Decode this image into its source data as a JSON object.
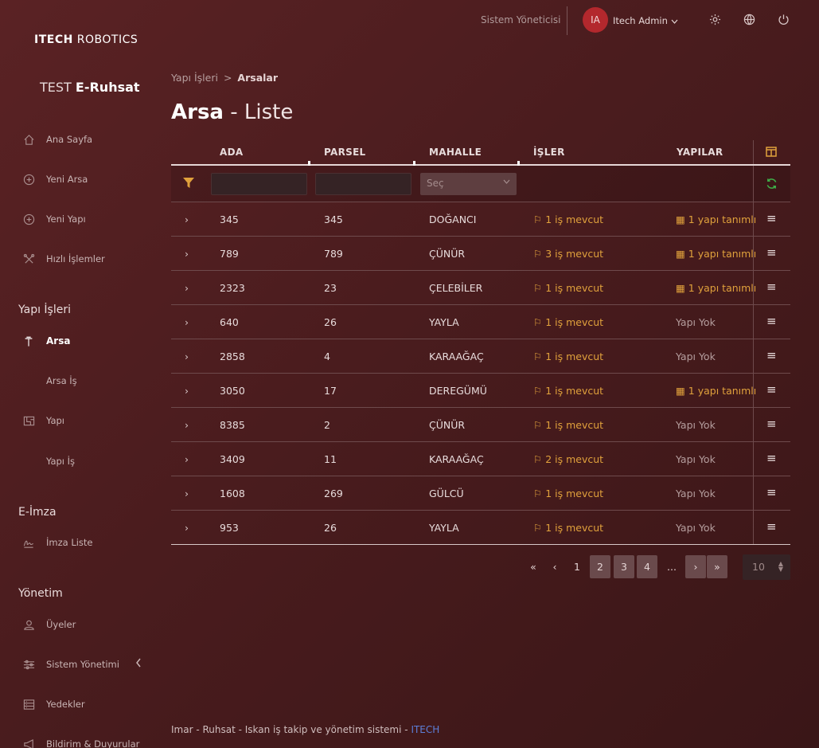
{
  "brand": {
    "logo_bold": "ITECH",
    "logo_rest": "ROBOTICS",
    "app_prefix": "TEST",
    "app_name": "E-Ruhsat"
  },
  "header": {
    "role": "Sistem Yöneticisi",
    "avatar_initials": "IA",
    "user_name": "Itech Admin"
  },
  "sidebar": {
    "items": [
      {
        "label": "Ana Sayfa"
      },
      {
        "label": "Yeni Arsa"
      },
      {
        "label": "Yeni Yapı"
      },
      {
        "label": "Hızlı İşlemler"
      }
    ],
    "section_yapi": "Yapı İşleri",
    "yapi_items": [
      {
        "label": "Arsa"
      },
      {
        "label": "Arsa İş"
      },
      {
        "label": "Yapı"
      },
      {
        "label": "Yapı İş"
      }
    ],
    "section_eimza": "E-İmza",
    "eimza_items": [
      {
        "label": "İmza Liste"
      }
    ],
    "section_yonetim": "Yönetim",
    "yonetim_items": [
      {
        "label": "Üyeler"
      },
      {
        "label": "Sistem Yönetimi"
      },
      {
        "label": "Yedekler"
      },
      {
        "label": "Bildirim & Duyurular"
      }
    ]
  },
  "breadcrumb": {
    "parent": "Yapı İşleri",
    "separator": ">",
    "current": "Arsalar"
  },
  "page": {
    "title_bold": "Arsa",
    "title_rest": "- Liste"
  },
  "table": {
    "columns": [
      "ADA",
      "PARSEL",
      "MAHALLE",
      "İŞLER",
      "YAPILAR"
    ],
    "select_placeholder": "Seç",
    "rows": [
      {
        "ada": "345",
        "parsel": "345",
        "mahalle": "DOĞANCI",
        "isler": "1 iş mevcut",
        "yapilar": "1 yapı tanımlı"
      },
      {
        "ada": "789",
        "parsel": "789",
        "mahalle": "ÇÜNÜR",
        "isler": "3 iş mevcut",
        "yapilar": "1 yapı tanımlı"
      },
      {
        "ada": "2323",
        "parsel": "23",
        "mahalle": "ÇELEBİLER",
        "isler": "1 iş mevcut",
        "yapilar": "1 yapı tanımlı"
      },
      {
        "ada": "640",
        "parsel": "26",
        "mahalle": "YAYLA",
        "isler": "1 iş mevcut",
        "yapilar": "Yapı Yok"
      },
      {
        "ada": "2858",
        "parsel": "4",
        "mahalle": "KARAAĞAÇ",
        "isler": "1 iş mevcut",
        "yapilar": "Yapı Yok"
      },
      {
        "ada": "3050",
        "parsel": "17",
        "mahalle": "DEREGÜMÜ",
        "isler": "1 iş mevcut",
        "yapilar": "1 yapı tanımlı"
      },
      {
        "ada": "8385",
        "parsel": "2",
        "mahalle": "ÇÜNÜR",
        "isler": "1 iş mevcut",
        "yapilar": "Yapı Yok"
      },
      {
        "ada": "3409",
        "parsel": "11",
        "mahalle": "KARAAĞAÇ",
        "isler": "2 iş mevcut",
        "yapilar": "Yapı Yok"
      },
      {
        "ada": "1608",
        "parsel": "269",
        "mahalle": "GÜLCÜ",
        "isler": "1 iş mevcut",
        "yapilar": "Yapı Yok"
      },
      {
        "ada": "953",
        "parsel": "26",
        "mahalle": "YAYLA",
        "isler": "1 iş mevcut",
        "yapilar": "Yapı Yok"
      }
    ]
  },
  "pagination": {
    "first": "«",
    "prev": "‹",
    "pages": [
      "1",
      "2",
      "3",
      "4"
    ],
    "ellipsis": "...",
    "next": "›",
    "last": "»",
    "per_page": "10"
  },
  "footer": {
    "text": "Imar - Ruhsat - Iskan iş takip ve yönetim sistemi -",
    "brand": "ITECH"
  },
  "colors": {
    "accent_orange": "#e0a13c",
    "avatar_red": "#b3282d",
    "refresh_green": "#3fae49",
    "link_blue": "#5d7fd8"
  }
}
